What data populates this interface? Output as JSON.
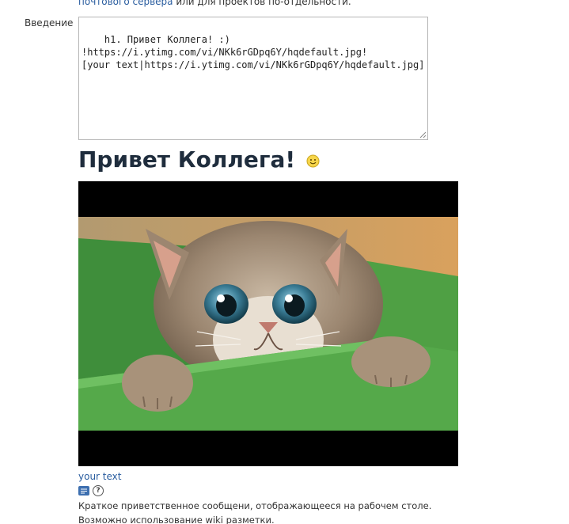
{
  "top_line": {
    "link_text": "почтового сервера",
    "rest_text": " или для проектов по-отдельности."
  },
  "field": {
    "label": "Введение",
    "value": "h1. Привет Коллега! :)\n!https://i.ytimg.com/vi/NKk6rGDpq6Y/hqdefault.jpg!\n[your text|https://i.ytimg.com/vi/NKk6rGDpq6Y/hqdefault.jpg]"
  },
  "preview": {
    "heading": "Привет Коллега!",
    "smiley_icon": "smiley-icon",
    "image_alt": "kitten-in-green-box-image",
    "link_text": "your text"
  },
  "toolbar": {
    "wiki_icon": "wiki-format-icon",
    "help_icon": "help-icon",
    "help_glyph": "?"
  },
  "hint": {
    "line1": "Краткое приветственное сообщени, отображающееся на рабочем столе.",
    "line2": "Возможно использование wiki разметки."
  },
  "colors": {
    "link": "#2a5d9f",
    "heading": "#1f2d3d",
    "wiki_icon_bg": "#3d6fb0"
  }
}
